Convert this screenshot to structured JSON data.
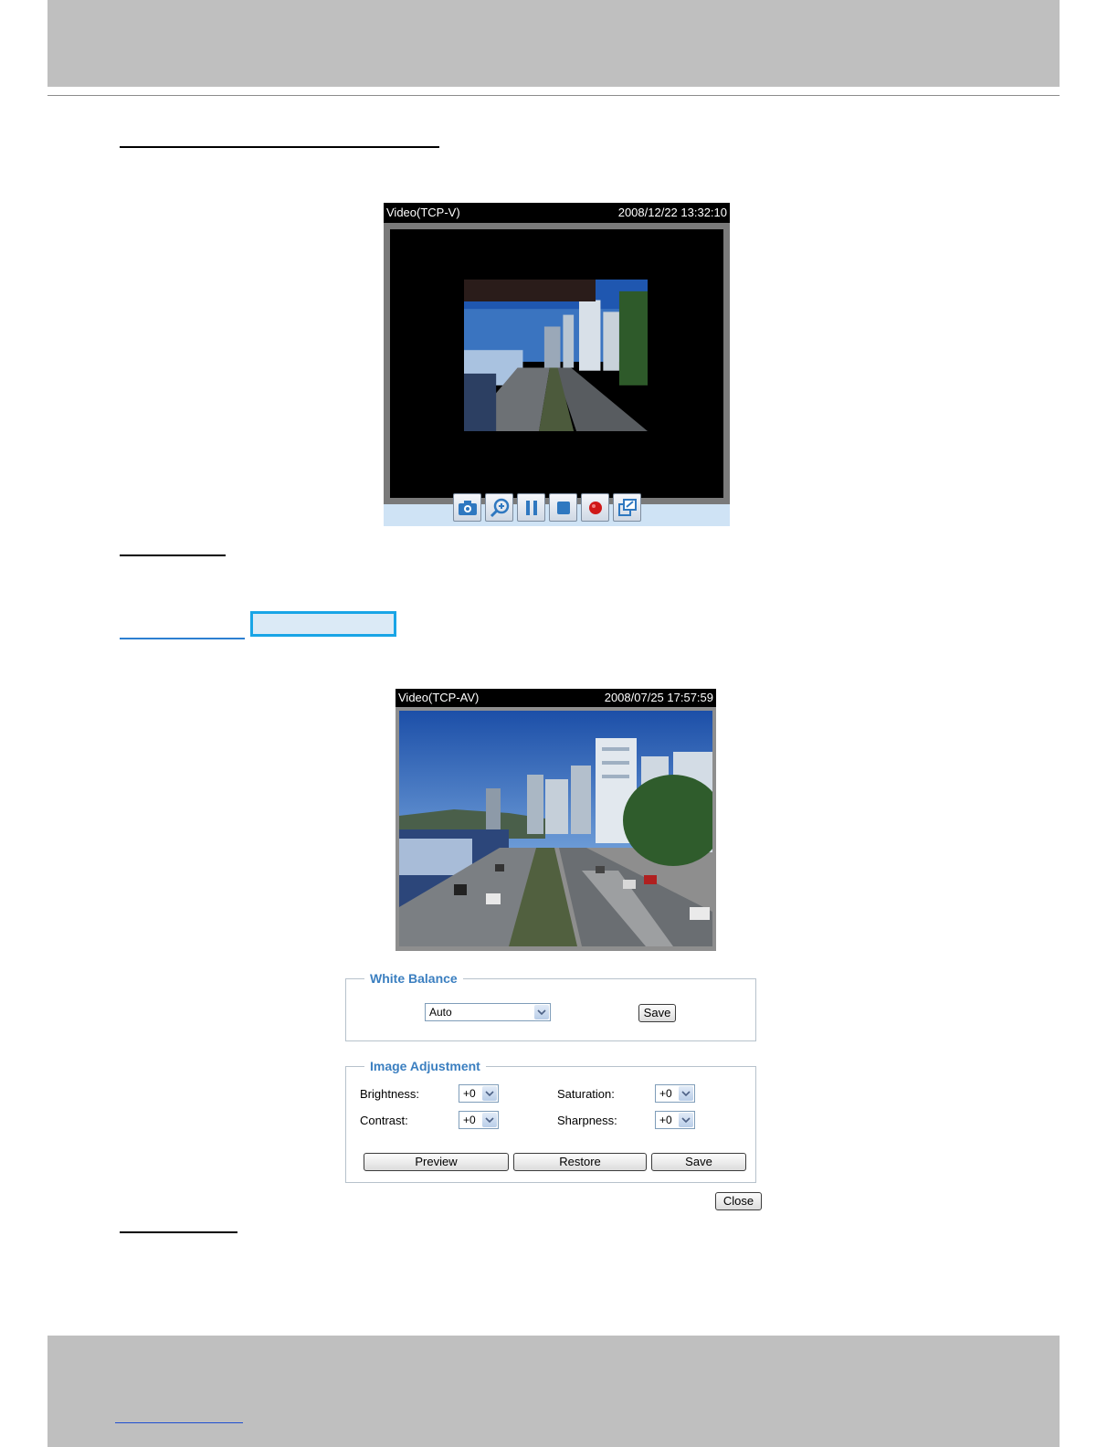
{
  "viewer1": {
    "protocol_label": "Video(TCP-V)",
    "timestamp": "2008/12/22 13:32:10",
    "toolbar_icons": [
      "camera-icon",
      "zoom-in-icon",
      "pause-icon",
      "stop-icon",
      "record-icon",
      "fullscreen-icon"
    ]
  },
  "viewer2": {
    "protocol_label": "Video(TCP-AV)",
    "timestamp": "2008/07/25 17:57:59"
  },
  "white_balance": {
    "legend": "White Balance",
    "mode_value": "Auto",
    "save_label": "Save"
  },
  "image_adjustment": {
    "legend": "Image Adjustment",
    "brightness_label": "Brightness:",
    "brightness_value": "+0",
    "saturation_label": "Saturation:",
    "saturation_value": "+0",
    "contrast_label": "Contrast:",
    "contrast_value": "+0",
    "sharpness_label": "Sharpness:",
    "sharpness_value": "+0",
    "preview_label": "Preview",
    "restore_label": "Restore",
    "save_label": "Save"
  },
  "close_label": "Close",
  "colors": {
    "legend_blue": "#3b7fc0",
    "toolbar_bg": "#cfe3f5",
    "highlight_border": "#19a5e6",
    "page_band_gray": "#bfbfbf"
  }
}
